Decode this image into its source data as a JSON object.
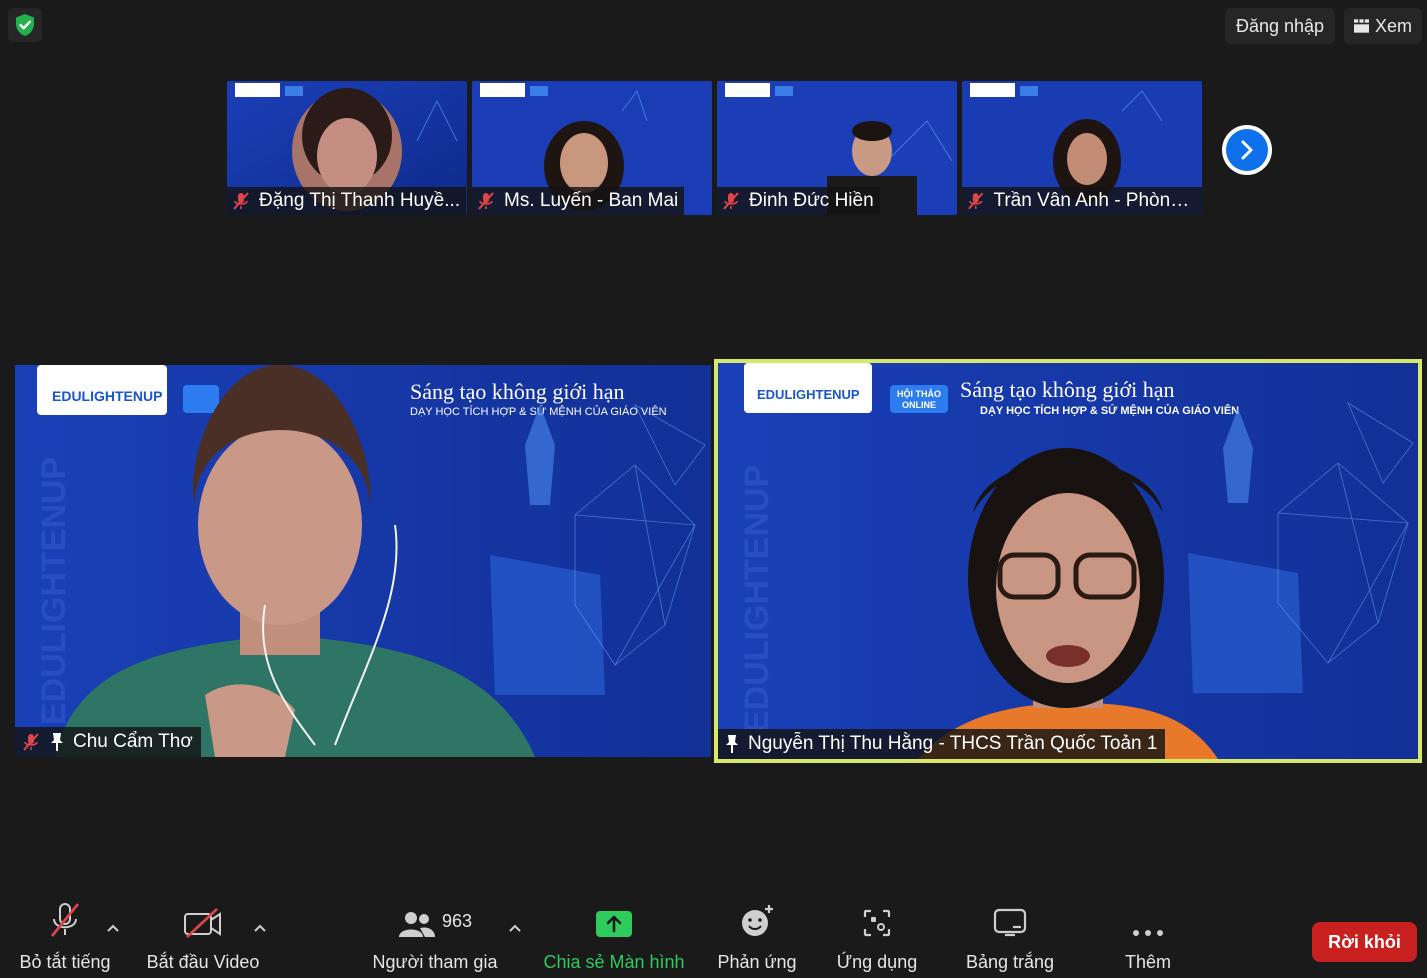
{
  "topbar": {
    "login_label": "Đăng nhập",
    "view_label": "Xem"
  },
  "thumbnails": [
    {
      "name": "Đặng Thị Thanh Huyề..."
    },
    {
      "name": "Ms. Luyến - Ban Mai"
    },
    {
      "name": "Đinh Đức Hiền"
    },
    {
      "name": "Trần Vân Anh - Phòng ..."
    }
  ],
  "tiles": {
    "left_name": "Chu Cẩm Thơ",
    "right_name": "Nguyễn Thị Thu Hằng - THCS Trần Quốc Toản 1"
  },
  "background": {
    "brand": "EDULIGHTENUP",
    "badge_line1": "HỘI THẢO",
    "badge_line2": "ONLINE",
    "headline": "Sáng tạo không giới hạn",
    "subheadline": "DẠY HỌC TÍCH HỢP & SỨ MỆNH CỦA GIÁO VIÊN",
    "watermark": "EDULIGHTENUP"
  },
  "toolbar": {
    "mute_label": "Bỏ tắt tiếng",
    "video_label": "Bắt đầu Video",
    "participants_label": "Người tham gia",
    "participants_count": "963",
    "share_label": "Chia sẻ Màn hình",
    "reactions_label": "Phản ứng",
    "apps_label": "Ứng dụng",
    "whiteboard_label": "Bảng trắng",
    "more_label": "Thêm",
    "leave_label": "Rời khỏi"
  },
  "colors": {
    "accent_blue": "#0e71eb",
    "share_green": "#2ecc5d",
    "leave_red": "#c8201f",
    "active_speaker": "#d8e86a",
    "muted_red": "#e0454a"
  }
}
